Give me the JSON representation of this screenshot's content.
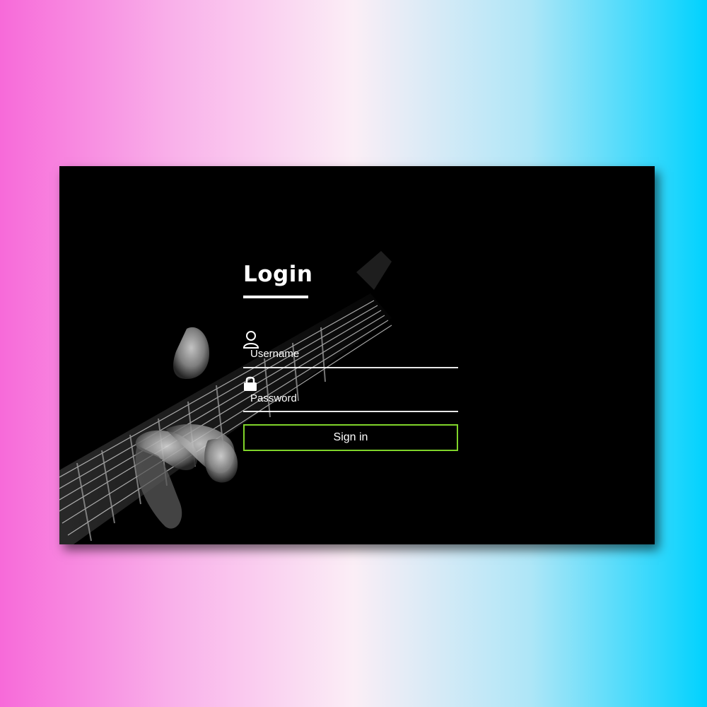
{
  "login": {
    "title": "Login",
    "username_label": "Username",
    "password_label": "Password",
    "signin_label": "Sign in"
  },
  "colors": {
    "card_background": "#000000",
    "text": "#ffffff",
    "button_border": "#80d42a",
    "gradient_left": "#f76ad9",
    "gradient_right": "#00d2fe"
  },
  "icons": {
    "username": "user-icon",
    "password": "lock-icon"
  }
}
